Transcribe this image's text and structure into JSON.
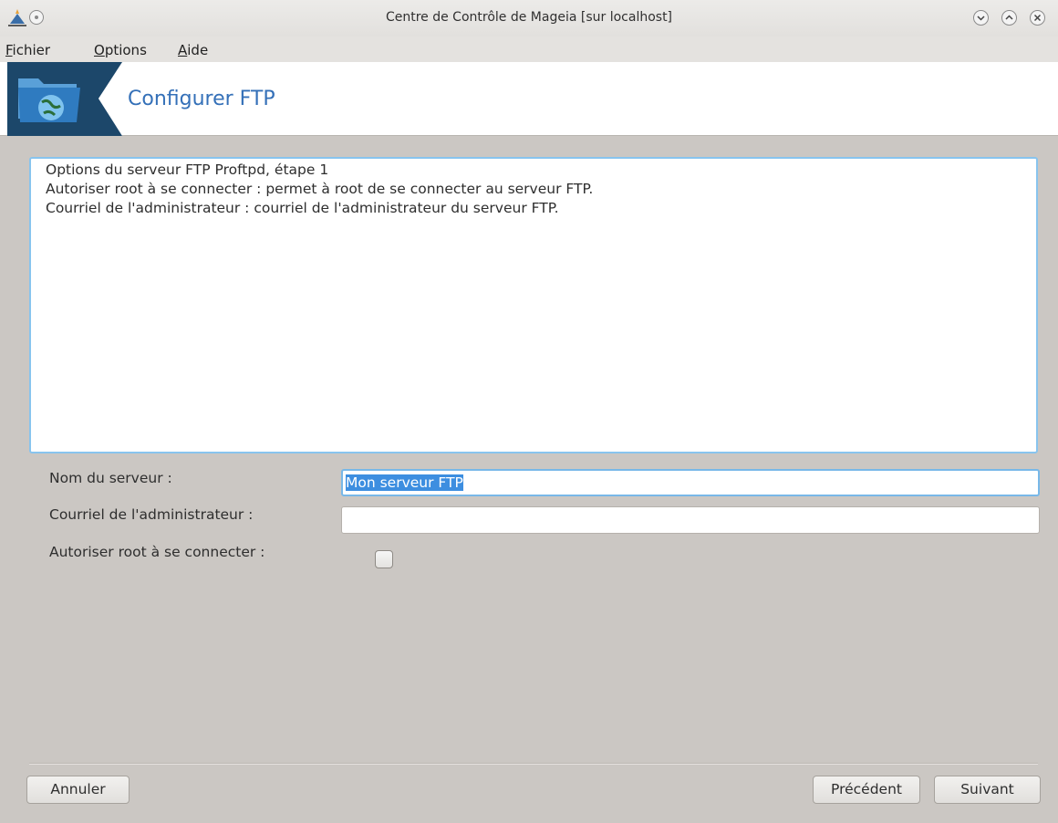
{
  "window": {
    "title": "Centre de Contrôle de Mageia  [sur localhost]"
  },
  "menu": {
    "items": [
      {
        "accel": "F",
        "rest": "ichier"
      },
      {
        "accel": "O",
        "rest": "ptions"
      },
      {
        "accel": "A",
        "rest": "ide"
      }
    ]
  },
  "header": {
    "title": "Configurer FTP",
    "icon": "network-folder-icon"
  },
  "description": {
    "lines": [
      "Options du serveur FTP Proftpd, étape 1",
      "",
      "Autoriser root à se connecter : permet à root de se connecter au serveur FTP.",
      "Courriel de l'administrateur : courriel de l'administrateur du serveur FTP."
    ]
  },
  "form": {
    "server_name_label": "Nom du serveur :",
    "server_name_value": "Mon serveur FTP",
    "admin_email_label": "Courriel de l'administrateur :",
    "admin_email_value": "",
    "allow_root_label": "Autoriser root à se connecter :",
    "allow_root_checked": false
  },
  "buttons": {
    "cancel": "Annuler",
    "previous": "Précédent",
    "next": "Suivant"
  },
  "colors": {
    "accent": "#3470b8",
    "focus": "#78b8e8",
    "selection": "#3d8ee0"
  }
}
